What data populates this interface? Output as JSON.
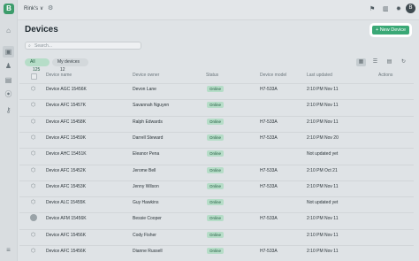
{
  "workspace": {
    "name": "Rink's",
    "caret": "∨"
  },
  "page": {
    "title": "Devices",
    "new_device_label": "+ New Device"
  },
  "search": {
    "placeholder": "Search..."
  },
  "filters": [
    {
      "label": "All",
      "count": "125"
    },
    {
      "label": "My devices",
      "count": "12"
    }
  ],
  "table": {
    "columns": [
      "Device name",
      "Device owner",
      "Status",
      "Device model",
      "Last updated",
      "Actions"
    ],
    "rows": [
      {
        "name": "Device AGC 15456K",
        "owner": "Devon Lane",
        "status": "Online",
        "model": "H7-533A",
        "updated": "2:10 PM Nov 11"
      },
      {
        "name": "Device AFC 15457K",
        "owner": "Savannah Nguyen",
        "status": "Online",
        "model": "",
        "updated": "2:10 PM Nov 11"
      },
      {
        "name": "Device AFC 15458K",
        "owner": "Ralph Edwards",
        "status": "Online",
        "model": "H7-533A",
        "updated": "2:10 PM Nov 11"
      },
      {
        "name": "Device AFC 15459K",
        "owner": "Darrell Steward",
        "status": "Online",
        "model": "H7-533A",
        "updated": "2:10 PM Nov 20"
      },
      {
        "name": "Device AHC 15451K",
        "owner": "Eleanor Pena",
        "status": "Online",
        "model": "",
        "updated": "Not updated yet"
      },
      {
        "name": "Device AFC 15452K",
        "owner": "Jerome Bell",
        "status": "Online",
        "model": "H7-533A",
        "updated": "2:10 PM Oct 21"
      },
      {
        "name": "Device AFC 15453K",
        "owner": "Jenny Wilson",
        "status": "Online",
        "model": "H7-533A",
        "updated": "2:10 PM Nov 11"
      },
      {
        "name": "Device ALC 15455K",
        "owner": "Guy Hawkins",
        "status": "Online",
        "model": "",
        "updated": "Not updated yet"
      },
      {
        "name": "Device AFM 15456K",
        "owner": "Bessie Cooper",
        "status": "Online",
        "model": "H7-533A",
        "updated": "2:10 PM Nov 11"
      },
      {
        "name": "Device AFC 15456K",
        "owner": "Cody Fisher",
        "status": "Online",
        "model": "",
        "updated": "2:10 PM Nov 11"
      },
      {
        "name": "Device AFC 15456K",
        "owner": "Dianne Russell",
        "status": "Online",
        "model": "H7-533A",
        "updated": "2:10 PM Nov 11"
      }
    ]
  },
  "colors": {
    "accent": "#3aa876",
    "status_bg": "#b6ddc8",
    "background": "#dfe3e6"
  }
}
